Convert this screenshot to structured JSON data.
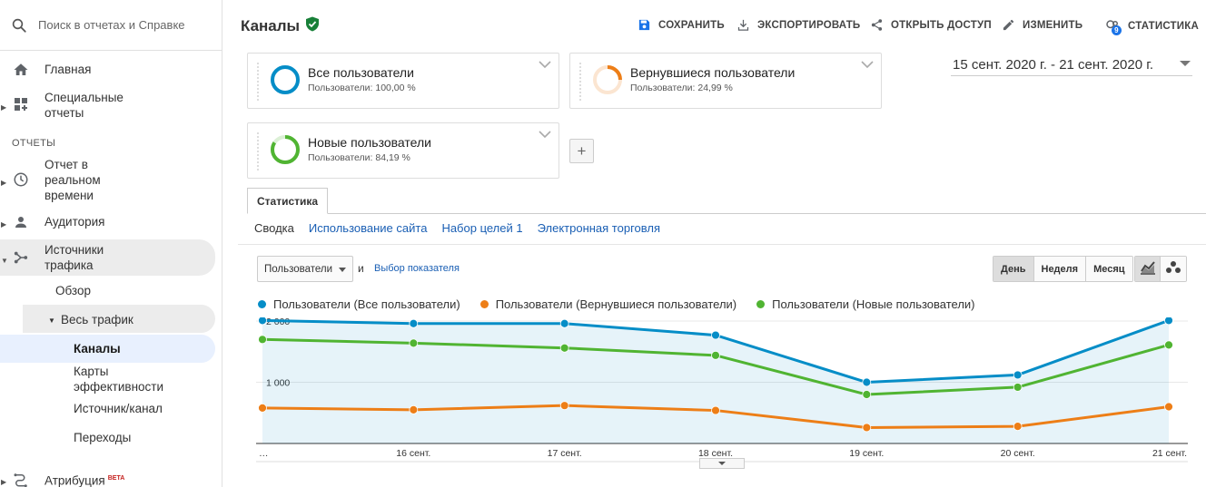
{
  "sidebar": {
    "search_placeholder": "Поиск в отчетах и Справке",
    "home": "Главная",
    "custom_reports": [
      "Специальные",
      "отчеты"
    ],
    "section": "ОТЧЕТЫ",
    "realtime": [
      "Отчет в",
      "реальном",
      "времени"
    ],
    "audience": "Аудитория",
    "acquisition": [
      "Источники",
      "трафика"
    ],
    "overview": "Обзор",
    "all_traffic": "Весь трафик",
    "channels": "Каналы",
    "treemaps": [
      "Карты",
      "эффективности"
    ],
    "source_medium": "Источник/канал",
    "referrals": "Переходы",
    "attribution": "Атрибуция",
    "attribution_badge": "BETA"
  },
  "header": {
    "title": "Каналы",
    "save": "СОХРАНИТЬ",
    "export": "ЭКСПОРТИРОВАТЬ",
    "share": "ОТКРЫТЬ ДОСТУП",
    "edit": "ИЗМЕНИТЬ",
    "insights": "СТАТИСТИКА",
    "insights_badge": "9"
  },
  "segments": [
    {
      "name": "Все пользователи",
      "sub": "Пользователи: 100,00 %",
      "pct": 1.0,
      "color": "#058dc7"
    },
    {
      "name": "Вернувшиеся пользователи",
      "sub": "Пользователи: 24,99 %",
      "pct": 0.2499,
      "color": "#ed7e17"
    },
    {
      "name": "Новые пользователи",
      "sub": "Пользователи: 84,19 %",
      "pct": 0.8419,
      "color": "#50b432"
    }
  ],
  "date_range": "15 сент. 2020 г. - 21 сент. 2020 г.",
  "tab": "Статистика",
  "subtabs": {
    "summary": "Сводка",
    "site_usage": "Использование сайта",
    "goal_set": "Набор целей 1",
    "ecommerce": "Электронная торговля"
  },
  "controls": {
    "metric": "Пользователи",
    "and": "и",
    "select_metric": "Выбор показателя",
    "day": "День",
    "week": "Неделя",
    "month": "Месяц"
  },
  "chart_data": {
    "type": "line",
    "x": [
      "…",
      "16 сент.",
      "17 сент.",
      "18 сент.",
      "19 сент.",
      "20 сент.",
      "21 сент."
    ],
    "yticks": [
      {
        "value": 1000,
        "label": "1 000"
      },
      {
        "value": 2000,
        "label": "2 000"
      }
    ],
    "ylim": [
      0,
      2060
    ],
    "series": [
      {
        "name": "Пользователи (Все пользователи)",
        "color": "#058dc7",
        "fill": true,
        "values": [
          2010,
          1960,
          1960,
          1770,
          1000,
          1120,
          2010
        ]
      },
      {
        "name": "Пользователи (Вернувшиеся пользователи)",
        "color": "#ed7e17",
        "fill": false,
        "values": [
          580,
          550,
          620,
          540,
          260,
          280,
          600
        ]
      },
      {
        "name": "Пользователи (Новые пользователи)",
        "color": "#50b432",
        "fill": false,
        "values": [
          1700,
          1640,
          1560,
          1440,
          800,
          920,
          1610
        ]
      }
    ]
  }
}
